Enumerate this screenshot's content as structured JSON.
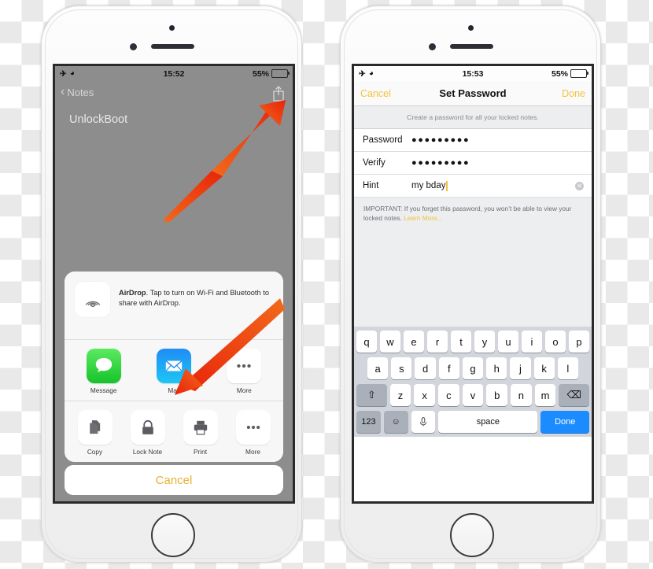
{
  "left_phone": {
    "status_bar": {
      "airplane_icon": "airplane-mode-icon",
      "wifi_icon": "wifi-icon",
      "time": "15:52",
      "battery_percent": "55%"
    },
    "nav": {
      "back_label": "Notes",
      "back_chevron": "‹",
      "share_icon": "share-icon"
    },
    "note": {
      "title": "UnlockBoot"
    },
    "share_sheet": {
      "airdrop": {
        "icon": "airdrop-icon",
        "bold_word": "AirDrop",
        "text": ". Tap to turn on Wi-Fi and Bluetooth to share with AirDrop."
      },
      "apps": [
        {
          "label": "Message",
          "icon": "messages-icon"
        },
        {
          "label": "Mail",
          "icon": "mail-icon"
        },
        {
          "label": "More",
          "icon": "more-dots-icon"
        }
      ],
      "actions": [
        {
          "label": "Copy",
          "icon": "copy-icon"
        },
        {
          "label": "Lock Note",
          "icon": "lock-icon"
        },
        {
          "label": "Print",
          "icon": "print-icon"
        },
        {
          "label": "More",
          "icon": "more-dots-icon"
        }
      ],
      "cancel_label": "Cancel"
    }
  },
  "right_phone": {
    "status_bar": {
      "airplane_icon": "airplane-mode-icon",
      "wifi_icon": "wifi-icon",
      "time": "15:53",
      "battery_percent": "55%"
    },
    "nav": {
      "cancel_label": "Cancel",
      "title": "Set Password",
      "done_label": "Done"
    },
    "subtitle": "Create a password for all your locked notes.",
    "fields": [
      {
        "label": "Password",
        "value": "●●●●●●●●●",
        "type": "password"
      },
      {
        "label": "Verify",
        "value": "●●●●●●●●●",
        "type": "password"
      },
      {
        "label": "Hint",
        "value": "my bday",
        "type": "text",
        "placeholder": "Hint"
      }
    ],
    "footer": {
      "text": "IMPORTANT: If you forget this password, you won’t be able to view your locked notes. ",
      "link": "Learn More..."
    },
    "keyboard": {
      "row1": [
        "q",
        "w",
        "e",
        "r",
        "t",
        "y",
        "u",
        "i",
        "o",
        "p"
      ],
      "row2": [
        "a",
        "s",
        "d",
        "f",
        "g",
        "h",
        "j",
        "k",
        "l"
      ],
      "row3_shift": "⇧",
      "row3": [
        "z",
        "x",
        "c",
        "v",
        "b",
        "n",
        "m"
      ],
      "row3_backspace": "⌫",
      "numbers_key": "123",
      "emoji_key": "☺",
      "mic_key": "ᵠ",
      "space_key": "space",
      "done_key": "Done"
    }
  },
  "colors": {
    "accent_yellow": "#f3c23c",
    "arrow_red": "#ef3b14",
    "keyboard_blue": "#1a8cff",
    "battery_yellow": "#fdc500"
  }
}
